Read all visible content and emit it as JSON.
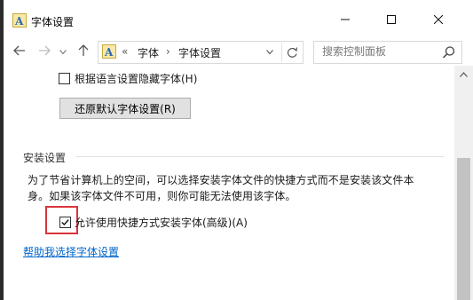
{
  "window": {
    "title": "字体设置"
  },
  "nav": {
    "breadcrumb_overflow": "«",
    "breadcrumb_root": "字体",
    "breadcrumb_sep": "›",
    "breadcrumb_current": "字体设置",
    "search_placeholder": "搜索控制面板"
  },
  "content": {
    "hide_fonts_label": "根据语言设置隐藏字体(H)",
    "hide_fonts_checked": false,
    "restore_button": "还原默认字体设置(R)",
    "install_section_title": "安装设置",
    "install_desc_line1": "为了节省计算机上的空间，可以选择安装字体文件的快捷方式而不是安装该文件本",
    "install_desc_line2": "身。如果该字体文件不可用，则你可能无法使用该字体。",
    "shortcut_label": "允许使用快捷方式安装字体(高级)(A)",
    "shortcut_checked": true,
    "help_link": "帮助我选择字体设置"
  },
  "colors": {
    "link": "#0066cc",
    "highlight": "#d8343a",
    "button_bg": "#e1e1e1",
    "scroll_thumb": "#c2c2c2"
  },
  "icons": {
    "app": "font-a-icon",
    "minimize": "minimize-icon",
    "maximize": "maximize-icon",
    "close": "close-icon",
    "back": "arrow-left-icon",
    "forward": "arrow-right-icon",
    "recent": "chevron-down-icon",
    "up": "arrow-up-icon",
    "refresh": "refresh-icon",
    "search": "search-icon"
  }
}
